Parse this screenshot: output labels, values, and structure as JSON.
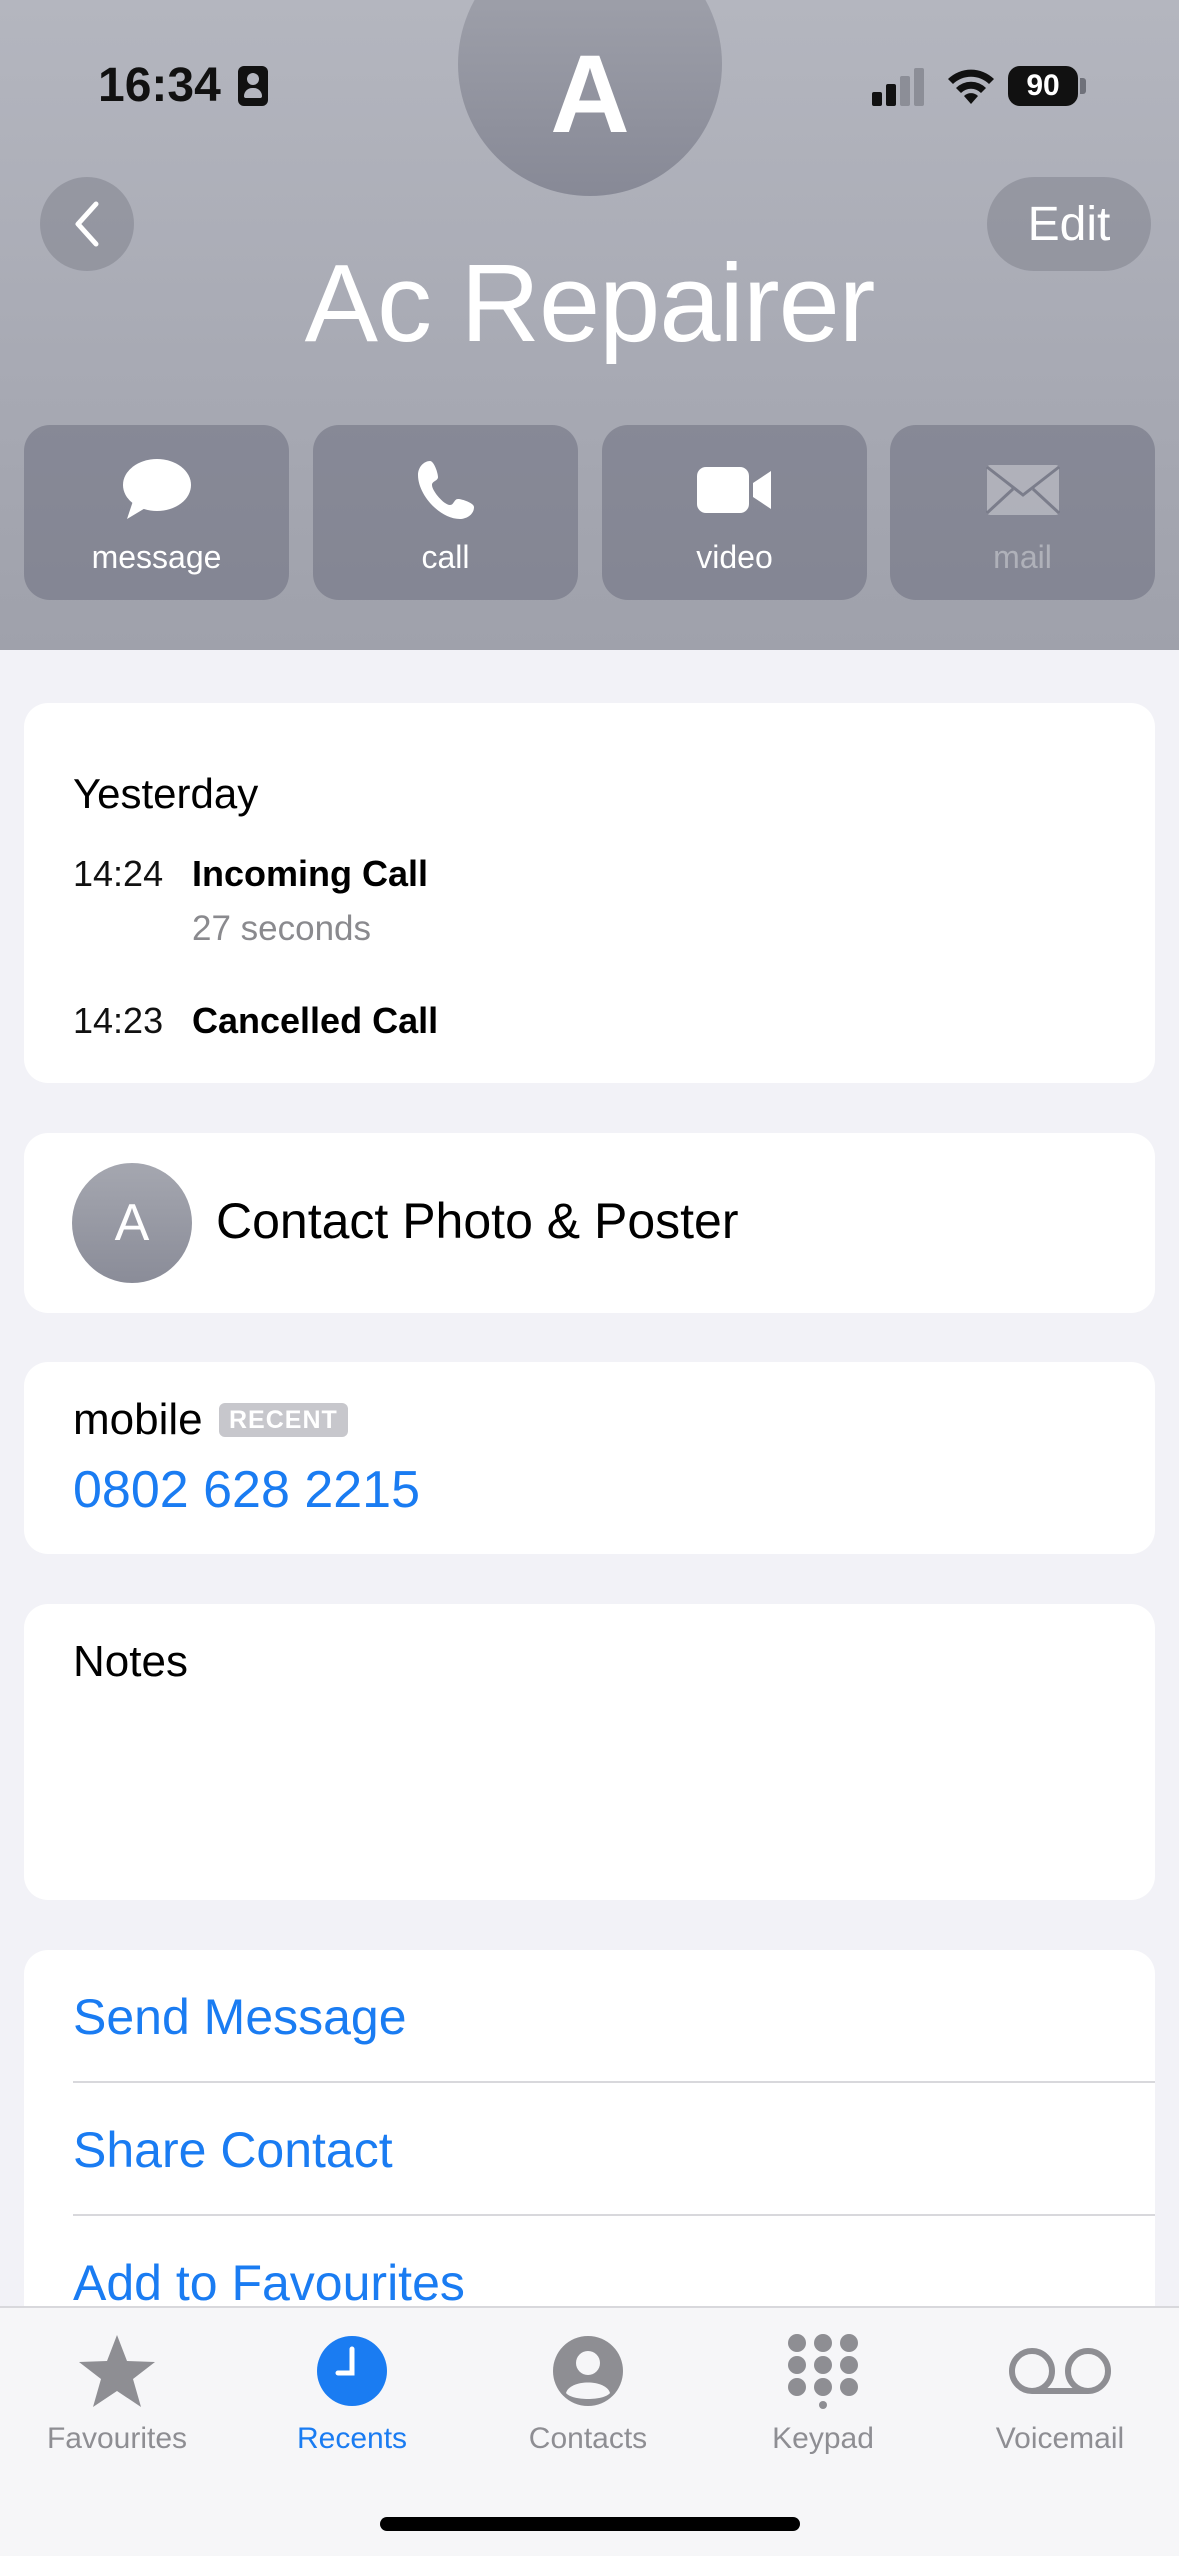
{
  "status_bar": {
    "time": "16:34",
    "battery": "90"
  },
  "header": {
    "avatar_letter": "A",
    "contact_name": "Ac Repairer",
    "edit_label": "Edit"
  },
  "actions": [
    {
      "label": "message",
      "icon": "message-bubble-icon",
      "enabled": true
    },
    {
      "label": "call",
      "icon": "phone-icon",
      "enabled": true
    },
    {
      "label": "video",
      "icon": "video-camera-icon",
      "enabled": true
    },
    {
      "label": "mail",
      "icon": "envelope-icon",
      "enabled": false
    }
  ],
  "call_history": {
    "day": "Yesterday",
    "calls": [
      {
        "time": "14:24",
        "type": "Incoming Call",
        "duration": "27 seconds"
      },
      {
        "time": "14:23",
        "type": "Cancelled Call",
        "duration": ""
      }
    ]
  },
  "contact_poster": {
    "avatar_letter": "A",
    "label": "Contact Photo & Poster"
  },
  "phone": {
    "label": "mobile",
    "badge": "RECENT",
    "number": "0802 628 2215"
  },
  "notes": {
    "label": "Notes"
  },
  "links": [
    "Send Message",
    "Share Contact",
    "Add to Favourites"
  ],
  "tabbar": {
    "active": "Recents",
    "tabs": [
      {
        "label": "Favourites",
        "icon": "star-icon"
      },
      {
        "label": "Recents",
        "icon": "clock-icon"
      },
      {
        "label": "Contacts",
        "icon": "person-circle-icon"
      },
      {
        "label": "Keypad",
        "icon": "keypad-icon"
      },
      {
        "label": "Voicemail",
        "icon": "voicemail-icon"
      }
    ]
  },
  "colors": {
    "accent": "#1a7cf2",
    "header_bg": "#a7a9b3"
  }
}
